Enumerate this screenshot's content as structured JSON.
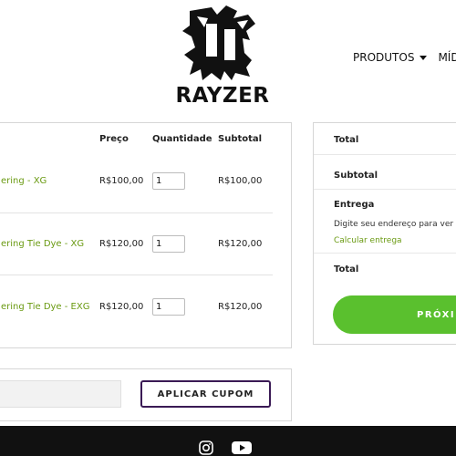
{
  "header": {
    "logo_text": "RAYZER",
    "nav": [
      {
        "label": "PRODUTOS",
        "has_dropdown": true
      },
      {
        "label": "MÍDI"
      }
    ]
  },
  "cart": {
    "columns": {
      "price": "Preço",
      "quantity": "Quantidade",
      "subtotal": "Subtotal"
    },
    "items": [
      {
        "name": "ering - XG",
        "price": "R$100,00",
        "quantity": "1",
        "subtotal": "R$100,00"
      },
      {
        "name": "ering Tie Dye - XG",
        "price": "R$120,00",
        "quantity": "1",
        "subtotal": "R$120,00"
      },
      {
        "name": "ering Tie Dye - EXG",
        "price": "R$120,00",
        "quantity": "1",
        "subtotal": "R$120,00"
      }
    ]
  },
  "coupon": {
    "button_label": "APLICAR CUPOM"
  },
  "totals": {
    "heading": "Total",
    "subtotal_label": "Subtotal",
    "shipping_label": "Entrega",
    "shipping_text": "Digite seu endereço para ver",
    "shipping_link": "Calcular entrega",
    "total_label": "Total",
    "next_button": "PRÓXIM"
  },
  "footer": {
    "icons": [
      "instagram-icon",
      "youtube-icon"
    ]
  },
  "colors": {
    "accent_green": "#5ac02e",
    "link_green": "#6a9a12",
    "coupon_border": "#3a1a55",
    "footer_bg": "#111111"
  }
}
